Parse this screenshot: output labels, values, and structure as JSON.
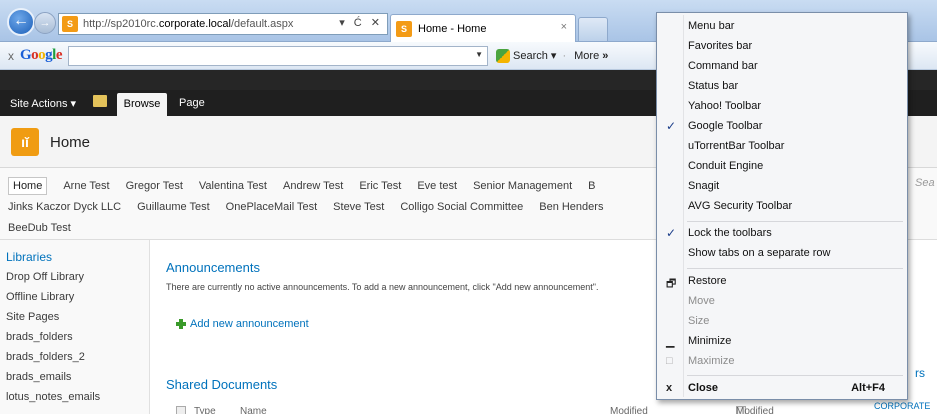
{
  "browser": {
    "url_prefix": "http://sp2010rc.",
    "url_domain": "corporate.local",
    "url_path": "/default.aspx",
    "address_buttons": "▾ Ć ✕",
    "tab_title": "Home - Home",
    "tab_close": "×"
  },
  "google_toolbar": {
    "close": "x",
    "logo": [
      "G",
      "o",
      "o",
      "g",
      "l",
      "e"
    ],
    "search_label": "Search",
    "more_label": "More",
    "more_arrows": "»"
  },
  "ribbon": {
    "site_actions": "Site Actions ▾",
    "browse": "Browse",
    "page": "Page"
  },
  "site": {
    "logo_glyph": "ıĭ",
    "title": "Home"
  },
  "topnav": {
    "row1": [
      "Home",
      "Arne Test",
      "Gregor Test",
      "Valentina Test",
      "Andrew Test",
      "Eric Test",
      "Eve test",
      "Senior Management",
      "B"
    ],
    "row2": [
      "Jinks Kaczor Dyck LLC",
      "Guillaume Test",
      "OnePlaceMail Test",
      "Steve Test",
      "Colligo Social Committee",
      "Ben Henders"
    ],
    "row3": [
      "BeeDub Test"
    ],
    "search_stub": "Sea"
  },
  "quick_launch": {
    "heading": "Libraries",
    "links": [
      "Drop Off Library",
      "Offline Library",
      "Site Pages",
      "brads_folders",
      "brads_folders_2",
      "brads_emails",
      "lotus_notes_emails"
    ]
  },
  "main": {
    "announcements_title": "Announcements",
    "announcements_text": "There are currently no active announcements. To add a new announcement, click \"Add new announcement\".",
    "add_announcement": "Add new announcement",
    "shared_documents_title": "Shared Documents",
    "col_type": "Type",
    "col_name": "Name",
    "col_modified": "Modified",
    "col_modified_by": "Modified By",
    "right_rs": "rs",
    "right_corporate": "CORPORATE"
  },
  "context_menu": {
    "items": [
      {
        "label": "Menu bar",
        "checked": false
      },
      {
        "label": "Favorites bar",
        "checked": false
      },
      {
        "label": "Command bar",
        "checked": false
      },
      {
        "label": "Status bar",
        "checked": false
      },
      {
        "label": "Yahoo! Toolbar",
        "checked": false
      },
      {
        "label": "Google Toolbar",
        "checked": true
      },
      {
        "label": "uTorrentBar Toolbar",
        "checked": false
      },
      {
        "label": "Conduit Engine",
        "checked": false
      },
      {
        "label": "Snagit",
        "checked": false
      },
      {
        "label": "AVG Security Toolbar",
        "checked": false
      }
    ],
    "group2": [
      {
        "label": "Lock the toolbars",
        "checked": true
      },
      {
        "label": "Show tabs on a separate row",
        "checked": false
      }
    ],
    "window": {
      "restore": "Restore",
      "move": "Move",
      "size": "Size",
      "minimize": "Minimize",
      "maximize": "Maximize",
      "close": "Close",
      "close_shortcut": "Alt+F4"
    },
    "check_glyph": "✓"
  }
}
